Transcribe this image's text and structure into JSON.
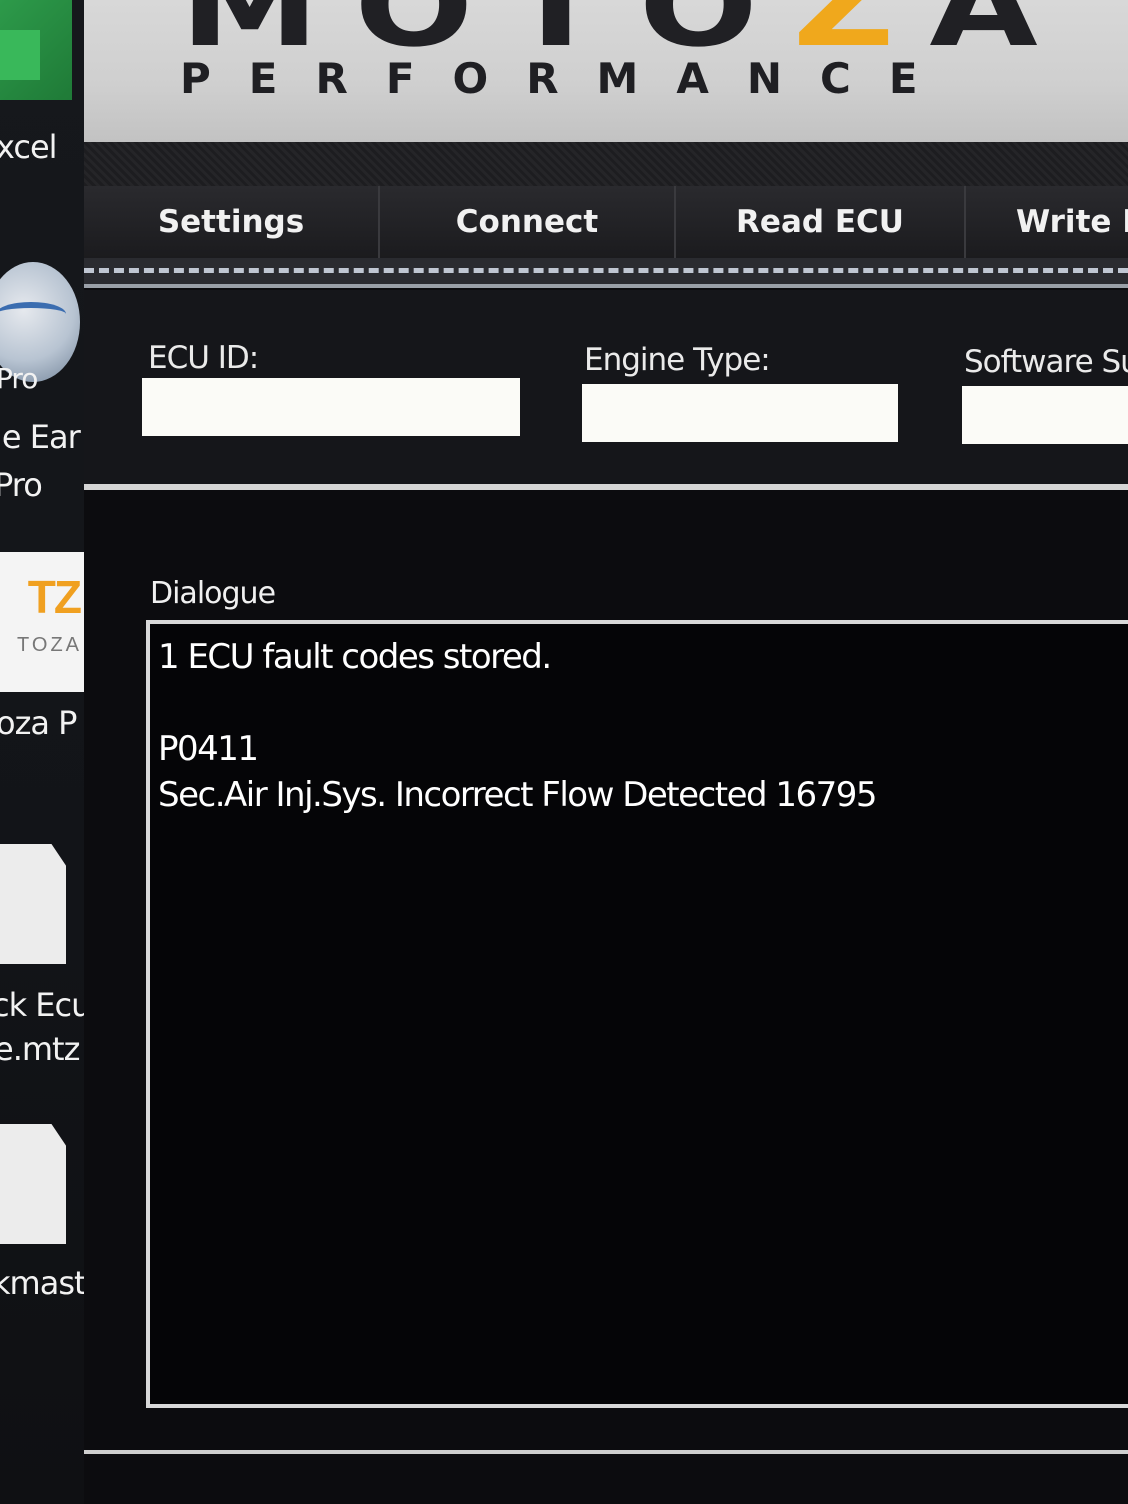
{
  "desktop": {
    "labels": [
      "xcel",
      "Pro",
      "le Ear",
      "Pro",
      "oza P",
      "ck Ecu",
      "e.mtz",
      "kmaste"
    ],
    "mtz_icon": {
      "letters": "TZ",
      "sub": "TOZA"
    }
  },
  "header": {
    "brand_main_left": "MOTO",
    "brand_main_accent": "Z",
    "brand_main_right": "A",
    "brand_sub": "PERFORMANCE"
  },
  "toolbar": {
    "tabs": [
      {
        "label": "Settings"
      },
      {
        "label": "Connect"
      },
      {
        "label": "Read ECU"
      },
      {
        "label": "Write E"
      }
    ]
  },
  "info": {
    "ecu_id_label": "ECU ID:",
    "ecu_id_value": "",
    "engine_type_label": "Engine Type:",
    "engine_type_value": "",
    "software_label": "Software Su",
    "software_value": ""
  },
  "dialogue": {
    "label": "Dialogue",
    "lines": [
      "1 ECU fault codes stored.",
      "",
      "P0411",
      "Sec.Air Inj.Sys. Incorrect Flow Detected 16795"
    ]
  },
  "colors": {
    "brand_accent": "#f0a81c",
    "panel_dark": "#0c0c0f",
    "text": "#ffffff"
  }
}
